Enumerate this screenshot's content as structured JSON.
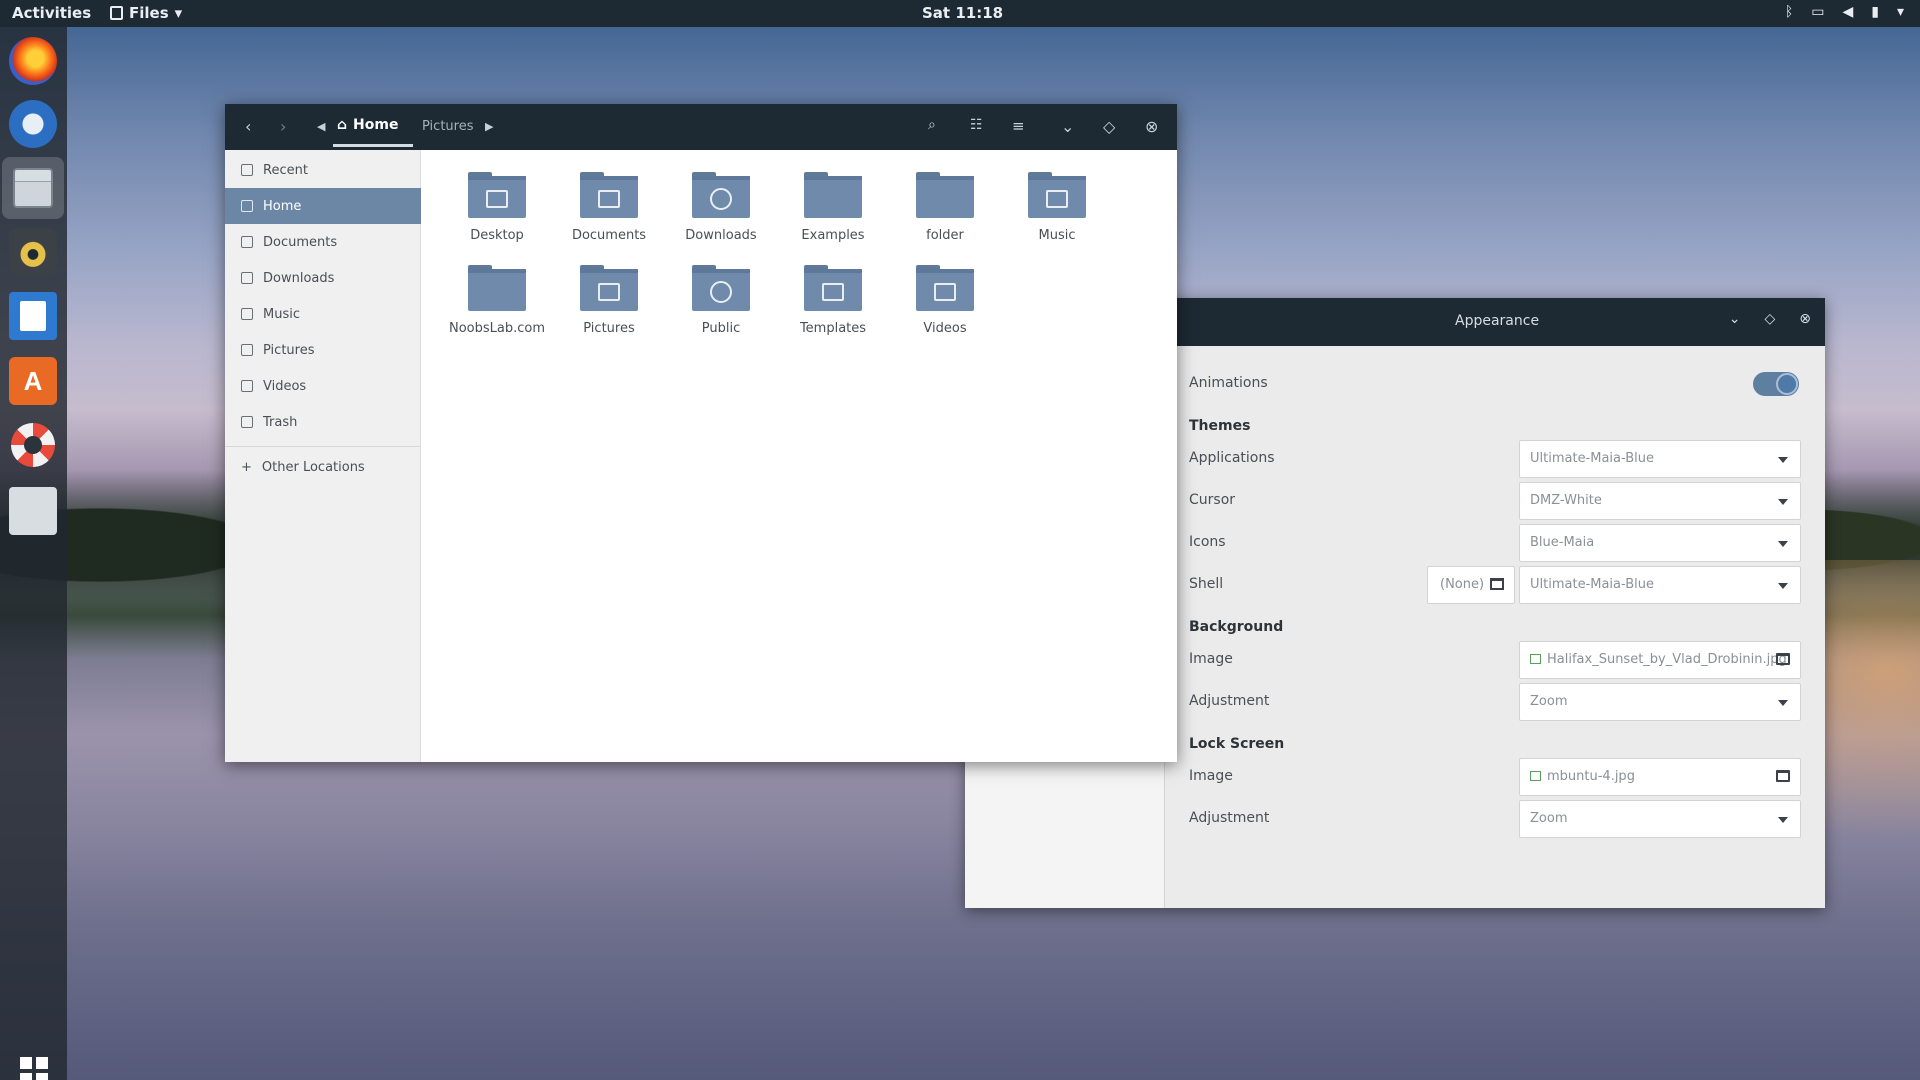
{
  "topbar": {
    "activities": "Activities",
    "app_menu": "Files",
    "app_menu_arrow": "▾",
    "clock": "Sat 11:18",
    "tray_icons": [
      "bluetooth-icon",
      "screen-icon",
      "volume-icon",
      "battery-icon",
      "menu-arrow-icon"
    ]
  },
  "dock": {
    "items": [
      "firefox",
      "thunderbird",
      "files",
      "rhythmbox",
      "libreoffice-writer",
      "software-center",
      "help",
      "tweaks"
    ],
    "show_apps": "apps-grid-icon",
    "store_glyph": "A"
  },
  "files_window": {
    "breadcrumb": {
      "home": "Home",
      "next": "Pictures"
    },
    "header_icons": [
      "back-icon",
      "forward-icon",
      "path-left-icon",
      "path-right-icon",
      "search-icon",
      "view-toggle-icon",
      "menu-icon",
      "minimize-icon",
      "maximize-icon",
      "close-icon"
    ],
    "sidebar": [
      {
        "label": "Recent",
        "icon": "clock-icon"
      },
      {
        "label": "Home",
        "icon": "home-icon",
        "selected": true
      },
      {
        "label": "Documents",
        "icon": "document-icon"
      },
      {
        "label": "Downloads",
        "icon": "download-icon"
      },
      {
        "label": "Music",
        "icon": "music-icon"
      },
      {
        "label": "Pictures",
        "icon": "picture-icon"
      },
      {
        "label": "Videos",
        "icon": "video-icon"
      },
      {
        "label": "Trash",
        "icon": "trash-icon"
      },
      {
        "label": "Other Locations",
        "icon": "plus-icon"
      }
    ],
    "folders": [
      {
        "label": "Desktop",
        "emblem": "monitor"
      },
      {
        "label": "Documents",
        "emblem": "document"
      },
      {
        "label": "Downloads",
        "emblem": "download"
      },
      {
        "label": "Examples",
        "emblem": "link"
      },
      {
        "label": "folder",
        "emblem": "none"
      },
      {
        "label": "Music",
        "emblem": "music"
      },
      {
        "label": "NoobsLab.com",
        "emblem": "none"
      },
      {
        "label": "Pictures",
        "emblem": "camera"
      },
      {
        "label": "Public",
        "emblem": "globe"
      },
      {
        "label": "Templates",
        "emblem": "template"
      },
      {
        "label": "Videos",
        "emblem": "film"
      }
    ]
  },
  "appearance_window": {
    "title": "Appearance",
    "animations": {
      "label": "Animations",
      "on": true
    },
    "themes": {
      "heading": "Themes",
      "applications": {
        "label": "Applications",
        "value": "Ultimate-Maia-Blue"
      },
      "cursor": {
        "label": "Cursor",
        "value": "DMZ-White"
      },
      "icons": {
        "label": "Icons",
        "value": "Blue-Maia"
      },
      "shell": {
        "label": "Shell",
        "extension_button": "(None)",
        "value": "Ultimate-Maia-Blue"
      }
    },
    "background": {
      "heading": "Background",
      "image": {
        "label": "Image",
        "value": "Halifax_Sunset_by_Vlad_Drobinin.jpg"
      },
      "adjustment": {
        "label": "Adjustment",
        "value": "Zoom"
      }
    },
    "lock_screen": {
      "heading": "Lock Screen",
      "image": {
        "label": "Image",
        "value": "mbuntu-4.jpg"
      },
      "adjustment": {
        "label": "Adjustment",
        "value": "Zoom"
      }
    }
  },
  "colors": {
    "topbar": "#1d2a33",
    "accent": "#6c87a6",
    "folder": "#6f8aaa",
    "toggle": "#4f79a6"
  }
}
